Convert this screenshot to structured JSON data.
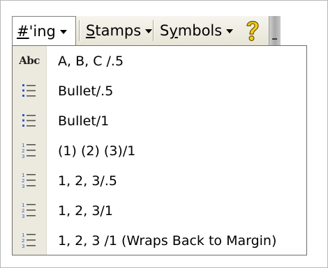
{
  "toolbar": {
    "numbering": {
      "label": "#'ing",
      "underline_char": "#"
    },
    "stamps": {
      "label": "Stamps",
      "underline_char": "S"
    },
    "symbols": {
      "label": "Symbols",
      "underline_char": "y"
    },
    "help_icon": "help-question-icon"
  },
  "menu": {
    "items": [
      {
        "icon": "abc-icon",
        "icon_text": "Abc",
        "label": "A, B, C /.5"
      },
      {
        "icon": "bullet-list-icon",
        "label": "Bullet/.5"
      },
      {
        "icon": "bullet-list-icon",
        "label": "Bullet/1"
      },
      {
        "icon": "numbered-list-icon",
        "label": "(1) (2) (3)/1"
      },
      {
        "icon": "numbered-list-icon",
        "label": "1, 2, 3/.5"
      },
      {
        "icon": "numbered-list-icon",
        "label": "1, 2, 3/1"
      },
      {
        "icon": "numbered-list-icon",
        "label": "1, 2, 3 /1 (Wraps Back to Margin)"
      }
    ]
  },
  "colors": {
    "toolbar_bg": "#ece9d8",
    "menu_gutter": "#eceadf",
    "icon_blue": "#2b58c4",
    "help_yellow": "#f1c40f"
  }
}
